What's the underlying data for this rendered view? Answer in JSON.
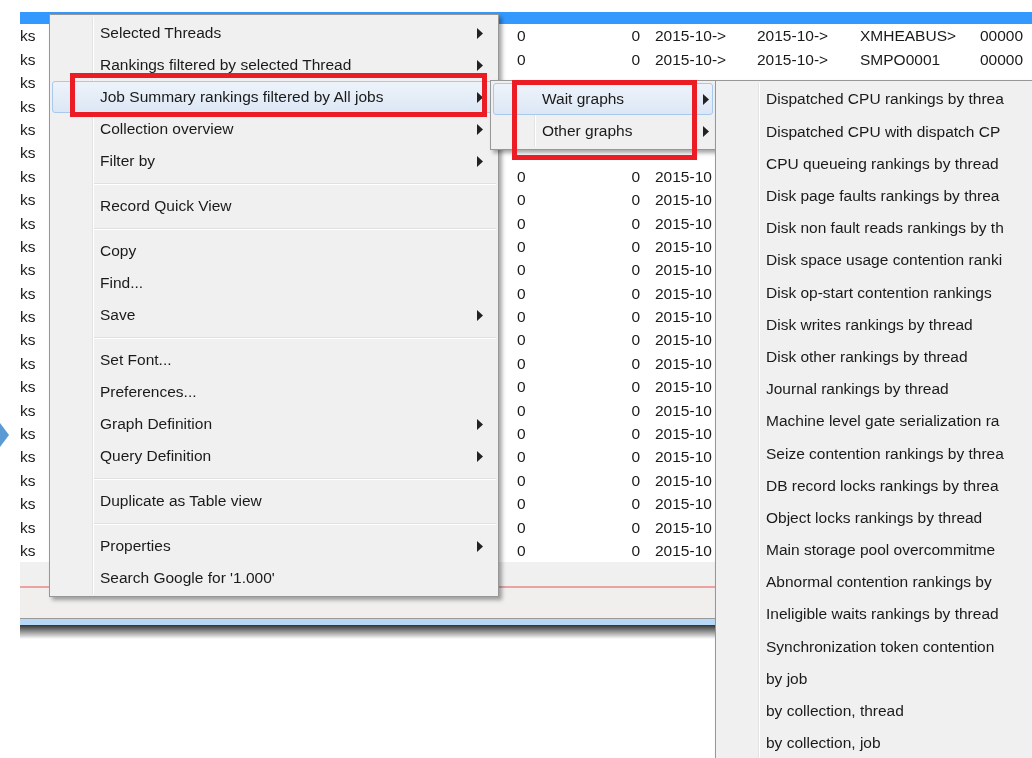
{
  "table": {
    "rows": [
      {
        "selected": true
      },
      {
        "selected": false,
        "cells": [
          "ks",
          "0",
          "0",
          "2015-10->",
          "2015-10->",
          "XMHEABUS>",
          "00000"
        ]
      },
      {
        "selected": false,
        "cells": [
          "ks",
          "0",
          "0",
          "2015-10->",
          "2015-10->",
          "SMPO0001",
          "00000"
        ]
      },
      {
        "selected": false,
        "cells": [
          "ks"
        ]
      },
      {
        "selected": false,
        "cells": [
          "ks"
        ]
      },
      {
        "selected": false,
        "cells": [
          "ks"
        ]
      },
      {
        "selected": false,
        "cells": [
          "ks"
        ]
      },
      {
        "selected": false,
        "cells": [
          "ks",
          "0",
          "0",
          "2015-10"
        ]
      },
      {
        "selected": false,
        "cells": [
          "ks",
          "0",
          "0",
          "2015-10"
        ]
      },
      {
        "selected": false,
        "cells": [
          "ks",
          "0",
          "0",
          "2015-10"
        ]
      },
      {
        "selected": false,
        "cells": [
          "ks",
          "0",
          "0",
          "2015-10"
        ]
      },
      {
        "selected": false,
        "cells": [
          "ks",
          "0",
          "0",
          "2015-10"
        ]
      },
      {
        "selected": false,
        "cells": [
          "ks",
          "0",
          "0",
          "2015-10"
        ]
      },
      {
        "selected": false,
        "cells": [
          "ks",
          "0",
          "0",
          "2015-10"
        ]
      },
      {
        "selected": false,
        "cells": [
          "ks",
          "0",
          "0",
          "2015-10"
        ]
      },
      {
        "selected": false,
        "cells": [
          "ks",
          "0",
          "0",
          "2015-10"
        ]
      },
      {
        "selected": false,
        "cells": [
          "ks",
          "0",
          "0",
          "2015-10"
        ]
      },
      {
        "selected": false,
        "cells": [
          "ks",
          "0",
          "0",
          "2015-10"
        ]
      },
      {
        "selected": false,
        "cells": [
          "ks",
          "0",
          "0",
          "2015-10"
        ]
      },
      {
        "selected": false,
        "cells": [
          "ks",
          "0",
          "0",
          "2015-10"
        ]
      },
      {
        "selected": false,
        "cells": [
          "ks",
          "0",
          "0",
          "2015-10"
        ]
      },
      {
        "selected": false,
        "cells": [
          "ks",
          "0",
          "0",
          "2015-10"
        ]
      },
      {
        "selected": false,
        "cells": [
          "ks",
          "0",
          "0",
          "2015-10"
        ]
      },
      {
        "selected": false,
        "cells": [
          "ks",
          "0",
          "0",
          "2015-10"
        ]
      }
    ]
  },
  "context_menu": {
    "items": [
      {
        "kind": "item",
        "label": "Selected Threads",
        "has_submenu": true,
        "selected": false
      },
      {
        "kind": "item",
        "label": "Rankings filtered by selected Thread",
        "has_submenu": true,
        "selected": false
      },
      {
        "kind": "item",
        "label": "Job Summary rankings filtered by All jobs",
        "has_submenu": true,
        "selected": true,
        "framed": true
      },
      {
        "kind": "item",
        "label": "Collection overview",
        "has_submenu": true,
        "selected": false
      },
      {
        "kind": "item",
        "label": "Filter by",
        "has_submenu": true,
        "selected": false
      },
      {
        "kind": "separator"
      },
      {
        "kind": "item",
        "label": "Record Quick View",
        "has_submenu": false,
        "selected": false
      },
      {
        "kind": "separator"
      },
      {
        "kind": "item",
        "label": "Copy",
        "has_submenu": false,
        "selected": false
      },
      {
        "kind": "item",
        "label": "Find...",
        "has_submenu": false,
        "selected": false
      },
      {
        "kind": "item",
        "label": "Save",
        "has_submenu": true,
        "selected": false
      },
      {
        "kind": "separator"
      },
      {
        "kind": "item",
        "label": "Set Font...",
        "has_submenu": false,
        "selected": false
      },
      {
        "kind": "item",
        "label": "Preferences...",
        "has_submenu": false,
        "selected": false
      },
      {
        "kind": "item",
        "label": "Graph Definition",
        "has_submenu": true,
        "selected": false
      },
      {
        "kind": "item",
        "label": "Query Definition",
        "has_submenu": true,
        "selected": false
      },
      {
        "kind": "separator"
      },
      {
        "kind": "item",
        "label": "Duplicate as Table view",
        "has_submenu": false,
        "selected": false
      },
      {
        "kind": "separator"
      },
      {
        "kind": "item",
        "label": "Properties",
        "has_submenu": true,
        "selected": false
      },
      {
        "kind": "item",
        "label": "Search Google for '1.000'",
        "has_submenu": false,
        "selected": false
      }
    ]
  },
  "submenu": {
    "framed": true,
    "items": [
      {
        "kind": "item",
        "label": "Wait graphs",
        "has_submenu": true,
        "selected": true
      },
      {
        "kind": "item",
        "label": "Other graphs",
        "has_submenu": true,
        "selected": false
      }
    ]
  },
  "sub_submenu": {
    "items": [
      {
        "kind": "item",
        "label": "Dispatched CPU rankings by threa",
        "selected": false
      },
      {
        "kind": "item",
        "label": "Dispatched CPU with dispatch CP",
        "selected": false
      },
      {
        "kind": "item",
        "label": "CPU queueing rankings by thread",
        "selected": false
      },
      {
        "kind": "item",
        "label": "Disk page faults rankings by threa",
        "selected": false
      },
      {
        "kind": "item",
        "label": "Disk non fault reads rankings by th",
        "selected": false
      },
      {
        "kind": "item",
        "label": "Disk space usage contention ranki",
        "selected": false
      },
      {
        "kind": "item",
        "label": "Disk op-start contention rankings",
        "selected": false
      },
      {
        "kind": "item",
        "label": "Disk writes rankings by thread",
        "selected": false
      },
      {
        "kind": "item",
        "label": "Disk other rankings by thread",
        "selected": false
      },
      {
        "kind": "item",
        "label": "Journal rankings by thread",
        "selected": false
      },
      {
        "kind": "item",
        "label": "Machine level gate serialization ra",
        "selected": false
      },
      {
        "kind": "item",
        "label": "Seize contention rankings by threa",
        "selected": false
      },
      {
        "kind": "item",
        "label": "DB record locks rankings by threa",
        "selected": false
      },
      {
        "kind": "item",
        "label": "Object locks rankings by thread",
        "selected": false
      },
      {
        "kind": "item",
        "label": "Main storage pool overcommitme",
        "selected": false
      },
      {
        "kind": "item",
        "label": "Abnormal contention rankings by",
        "selected": false
      },
      {
        "kind": "item",
        "label": "Ineligible waits rankings by thread",
        "selected": false
      },
      {
        "kind": "item",
        "label": "Synchronization token contention",
        "selected": false
      },
      {
        "kind": "item",
        "label": "by job",
        "selected": false
      },
      {
        "kind": "item",
        "label": "by collection, thread",
        "selected": false
      },
      {
        "kind": "item",
        "label": "by collection, job",
        "selected": false
      }
    ]
  }
}
